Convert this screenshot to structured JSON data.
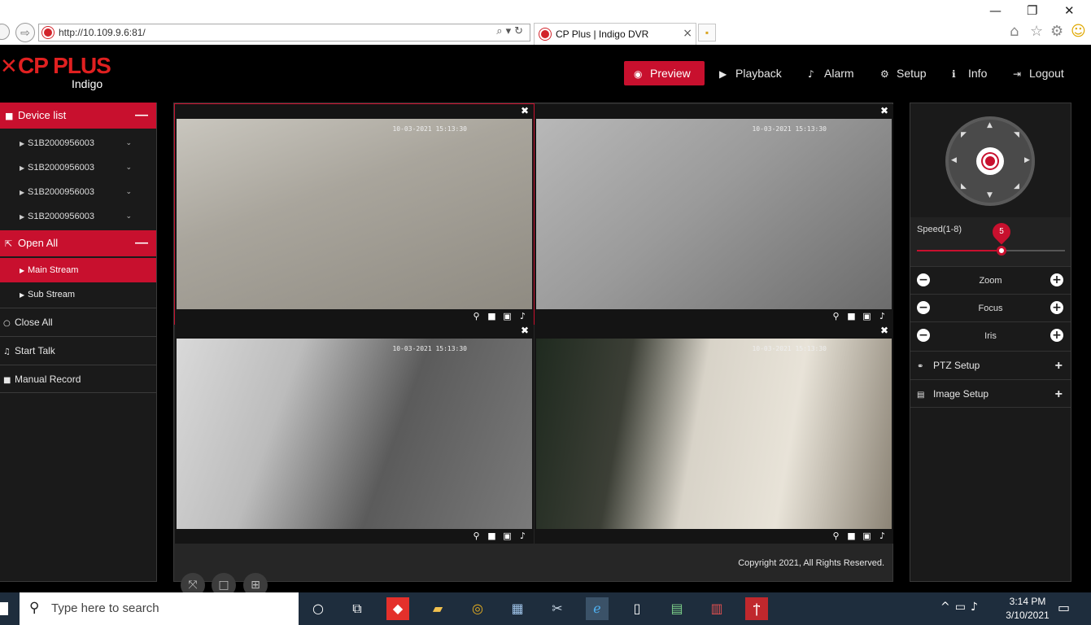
{
  "browser": {
    "url": "http://10.109.9.6:81/",
    "tab_title": "CP Plus | Indigo DVR",
    "minimize_glyph": "—",
    "restore_glyph": "❐",
    "close_glyph": "✕"
  },
  "header": {
    "brand": "CP PLUS",
    "sub_brand": "Indigo",
    "nav": [
      {
        "label": "Preview",
        "icon": "eye-icon",
        "active": true
      },
      {
        "label": "Playback",
        "icon": "play-circle-icon"
      },
      {
        "label": "Alarm",
        "icon": "bell-icon"
      },
      {
        "label": "Setup",
        "icon": "gear-icon"
      },
      {
        "label": "Info",
        "icon": "info-icon"
      },
      {
        "label": "Logout",
        "icon": "logout-icon"
      }
    ]
  },
  "sidebar": {
    "device_list_label": "Device list",
    "devices": [
      {
        "label": "S1B2000956003"
      },
      {
        "label": "S1B2000956003"
      },
      {
        "label": "S1B2000956003"
      },
      {
        "label": "S1B2000956003"
      }
    ],
    "open_all_label": "Open All",
    "streams": [
      {
        "label": "Main Stream",
        "selected": true
      },
      {
        "label": "Sub Stream",
        "selected": false
      }
    ],
    "actions": [
      {
        "label": "Close All",
        "icon": "circle-icon"
      },
      {
        "label": "Start Talk",
        "icon": "microphone-icon"
      },
      {
        "label": "Manual Record",
        "icon": "video-camera-icon"
      }
    ]
  },
  "video": {
    "cells": [
      {
        "timestamp": "10-03-2021 15:13:30",
        "selected": true
      },
      {
        "timestamp": "10-03-2021 15:13:30",
        "selected": false
      },
      {
        "timestamp": "10-03-2021 15:13:30",
        "selected": false
      },
      {
        "timestamp": "10-03-2021 15:13:30",
        "selected": false
      }
    ],
    "copyright": "Copyright 2021, All Rights Reserved."
  },
  "ptz": {
    "speed_label": "Speed(1-8)",
    "speed_value": "5",
    "speed_min": 1,
    "speed_max": 8,
    "zoom_label": "Zoom",
    "focus_label": "Focus",
    "iris_label": "Iris",
    "ptz_setup_label": "PTZ Setup",
    "image_setup_label": "Image Setup"
  },
  "taskbar": {
    "search_placeholder": "Type here to search",
    "time": "3:14 PM",
    "date": "3/10/2021"
  },
  "colors": {
    "accent": "#c8102e",
    "panel": "#1a1a1a",
    "taskbar": "#1e2d3d"
  }
}
